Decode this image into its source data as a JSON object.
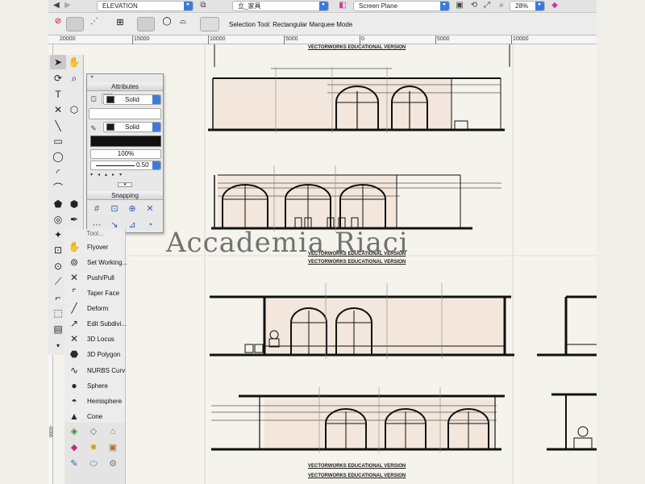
{
  "top_bar": {
    "layer_dropdown": "ELEVATION",
    "class_dropdown": "立_家具",
    "plane_dropdown": "Screen Plane",
    "zoom": "28%"
  },
  "mode_bar": {
    "status": "Selection Tool: Rectangular Marquee Mode"
  },
  "ruler": {
    "labels": [
      "20000",
      "15000",
      "10000",
      "5000",
      "0",
      "5000",
      "10000"
    ],
    "vertical_label": "-5000"
  },
  "attributes": {
    "title": "Attributes",
    "fill_style": "Solid",
    "pen_style": "Solid",
    "opacity": "100%",
    "line_weight": "0.50"
  },
  "snapping": {
    "title": "Snapping"
  },
  "toolset": {
    "header": "Tool...",
    "items": [
      {
        "label": "Flyover",
        "icon": "flyover-icon"
      },
      {
        "label": "Set Working...",
        "icon": "set-working-plane-icon"
      },
      {
        "label": "Push/Pull",
        "icon": "push-pull-icon"
      },
      {
        "label": "Taper Face",
        "icon": "taper-face-icon"
      },
      {
        "label": "Deform",
        "icon": "deform-icon"
      },
      {
        "label": "Edit Subdivi...",
        "icon": "edit-subdivision-icon"
      },
      {
        "label": "3D Locus",
        "icon": "3d-locus-icon"
      },
      {
        "label": "3D Polygon",
        "icon": "3d-polygon-icon"
      },
      {
        "label": "NURBS Curv",
        "icon": "nurbs-curve-icon"
      },
      {
        "label": "Sphere",
        "icon": "sphere-icon"
      },
      {
        "label": "Hemisphere",
        "icon": "hemisphere-icon"
      },
      {
        "label": "Cone",
        "icon": "cone-icon"
      }
    ]
  },
  "drawing": {
    "edu_stamp": "VECTORWORKS EDUCATIONAL VERSION",
    "watermark": "Accademia Riaci"
  },
  "colors": {
    "accent": "#3d7bd9",
    "wall_fill": "#f3e6dc",
    "paper": "#f4f3ec"
  }
}
